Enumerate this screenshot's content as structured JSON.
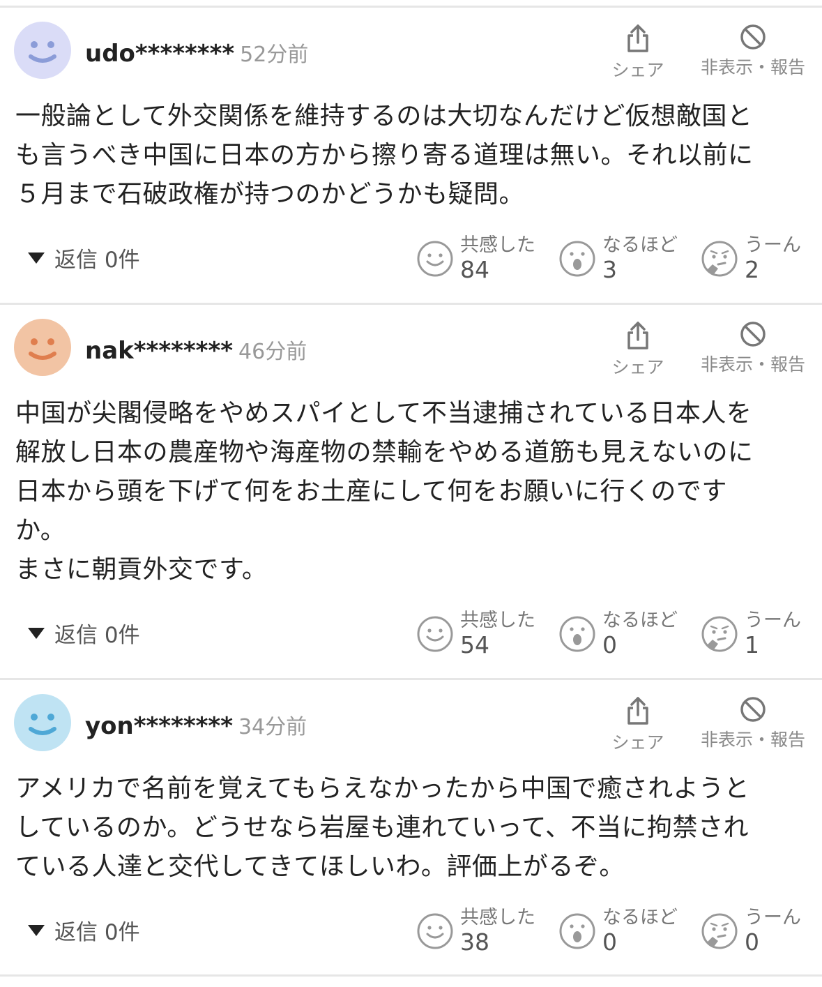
{
  "actions": {
    "share_label": "シェア",
    "hide_label": "非表示・報告"
  },
  "reactions_labels": {
    "empathy": "共感した",
    "naruhodo": "なるほど",
    "uun": "うーん"
  },
  "comments": [
    {
      "username": "udo********",
      "time": "52分前",
      "avatar_color": "#dadcf7",
      "avatar_face_color": "#8b9cd8",
      "lines": [
        "一般論として外交関係を維持するのは大切なんだけど仮想敵国と",
        "も言うべき中国に日本の方から擦り寄る道理は無い。それ以前に",
        "５月まで石破政権が持つのかどうかも疑問。"
      ],
      "reply": "返信 0件",
      "empathy": "84",
      "naruhodo": "3",
      "uun": "2"
    },
    {
      "username": "nak********",
      "time": "46分前",
      "avatar_color": "#f2c4a4",
      "avatar_face_color": "#e07e4e",
      "lines": [
        "中国が尖閣侵略をやめスパイとして不当逮捕されている日本人を",
        "解放し日本の農産物や海産物の禁輸をやめる道筋も見えないのに",
        "日本から頭を下げて何をお土産にして何をお願いに行くのです",
        "か。",
        "まさに朝貢外交です。"
      ],
      "reply": "返信 0件",
      "empathy": "54",
      "naruhodo": "0",
      "uun": "1"
    },
    {
      "username": "yon********",
      "time": "34分前",
      "avatar_color": "#bfe3f3",
      "avatar_face_color": "#4ea8d6",
      "lines": [
        "アメリカで名前を覚えてもらえなかったから中国で癒されようと",
        "しているのか。どうせなら岩屋も連れていって、不当に拘禁され",
        "ている人達と交代してきてほしいわ。評価上がるぞ。"
      ],
      "reply": "返信 0件",
      "empathy": "38",
      "naruhodo": "0",
      "uun": "0"
    }
  ]
}
